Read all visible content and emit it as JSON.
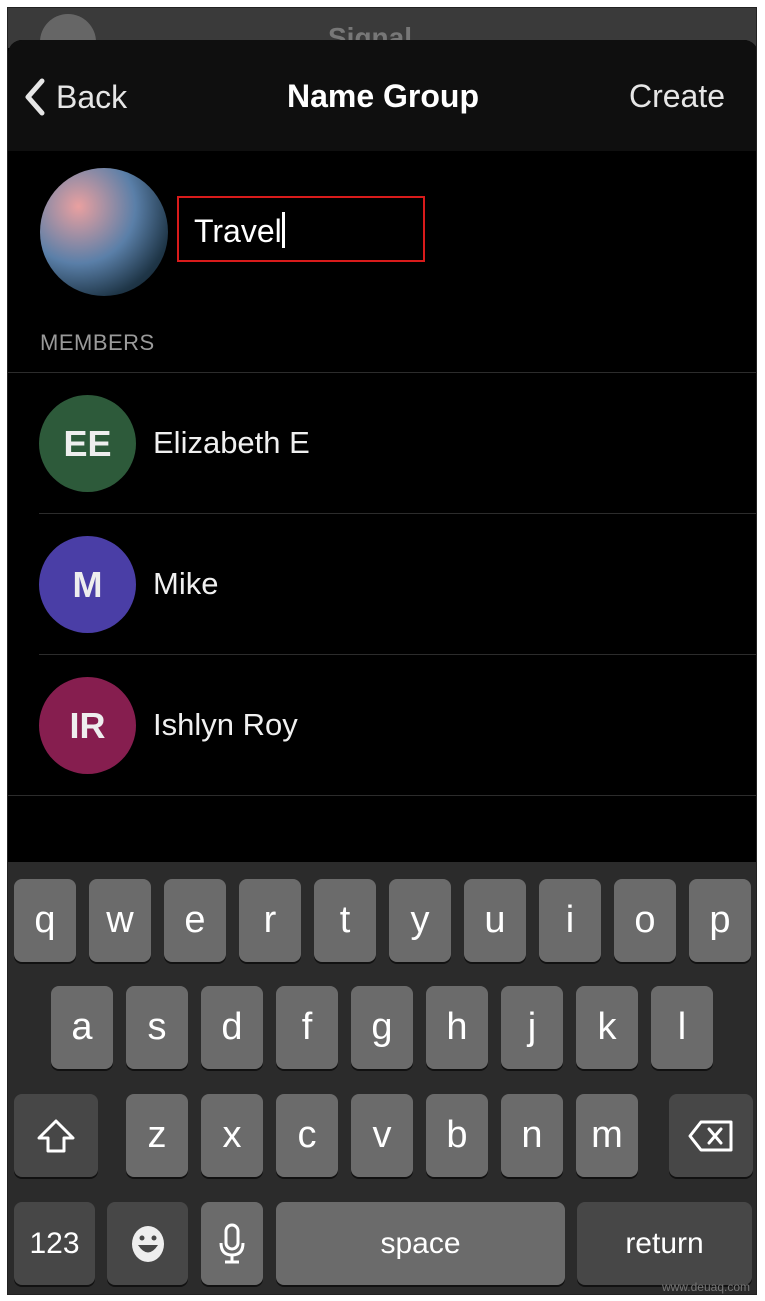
{
  "background_app": {
    "title": "Signal"
  },
  "nav": {
    "back_label": "Back",
    "title": "Name Group",
    "create_label": "Create"
  },
  "group_name": {
    "value": "Travel"
  },
  "members_header": "MEMBERS",
  "members": [
    {
      "initials": "EE",
      "name": "Elizabeth E",
      "color": "#2d5a3a"
    },
    {
      "initials": "M",
      "name": "Mike",
      "color": "#4a3ea6"
    },
    {
      "initials": "IR",
      "name": "Ishlyn Roy",
      "color": "#861e4f"
    }
  ],
  "keyboard": {
    "row1": [
      "q",
      "w",
      "e",
      "r",
      "t",
      "y",
      "u",
      "i",
      "o",
      "p"
    ],
    "row2": [
      "a",
      "s",
      "d",
      "f",
      "g",
      "h",
      "j",
      "k",
      "l"
    ],
    "row3": [
      "z",
      "x",
      "c",
      "v",
      "b",
      "n",
      "m"
    ],
    "numbers_label": "123",
    "space_label": "space",
    "return_label": "return",
    "icons": {
      "shift": "shift-icon",
      "backspace": "backspace-icon",
      "emoji": "emoji-icon",
      "mic": "microphone-icon"
    }
  },
  "watermark": "www.deuaq.com"
}
